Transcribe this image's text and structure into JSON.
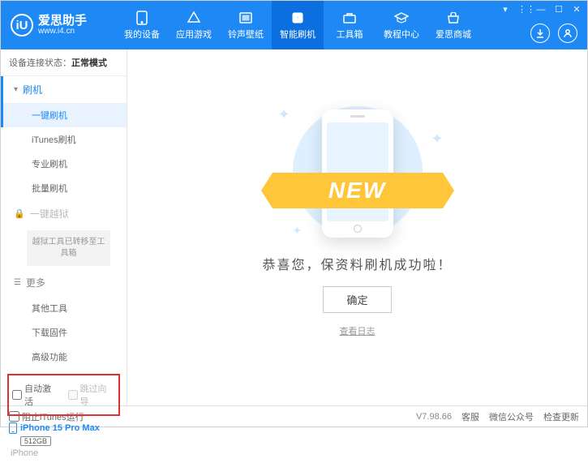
{
  "app": {
    "title": "爱思助手",
    "subtitle": "www.i4.cn"
  },
  "nav": {
    "items": [
      {
        "label": "我的设备"
      },
      {
        "label": "应用游戏"
      },
      {
        "label": "铃声壁纸"
      },
      {
        "label": "智能刷机",
        "active": true
      },
      {
        "label": "工具箱"
      },
      {
        "label": "教程中心"
      },
      {
        "label": "爱思商城"
      }
    ]
  },
  "status": {
    "prefix": "设备连接状态：",
    "value": "正常模式"
  },
  "sidebar": {
    "flash_header": "刷机",
    "flash_items": [
      "一键刷机",
      "iTunes刷机",
      "专业刷机",
      "批量刷机"
    ],
    "jailbreak_header": "一键越狱",
    "jailbreak_note": "越狱工具已转移至工具箱",
    "more_header": "更多",
    "more_items": [
      "其他工具",
      "下载固件",
      "高级功能"
    ],
    "checkboxes": {
      "auto_activate": "自动激活",
      "skip_setup": "跳过向导"
    }
  },
  "device": {
    "name": "iPhone 15 Pro Max",
    "storage": "512GB",
    "brand": "iPhone"
  },
  "main": {
    "ribbon": "NEW",
    "success": "恭喜您，保资料刷机成功啦！",
    "ok": "确定",
    "view_log": "查看日志"
  },
  "statusbar": {
    "block_itunes": "阻止iTunes运行",
    "version": "V7.98.66",
    "kefu": "客服",
    "wechat": "微信公众号",
    "update": "检查更新"
  }
}
